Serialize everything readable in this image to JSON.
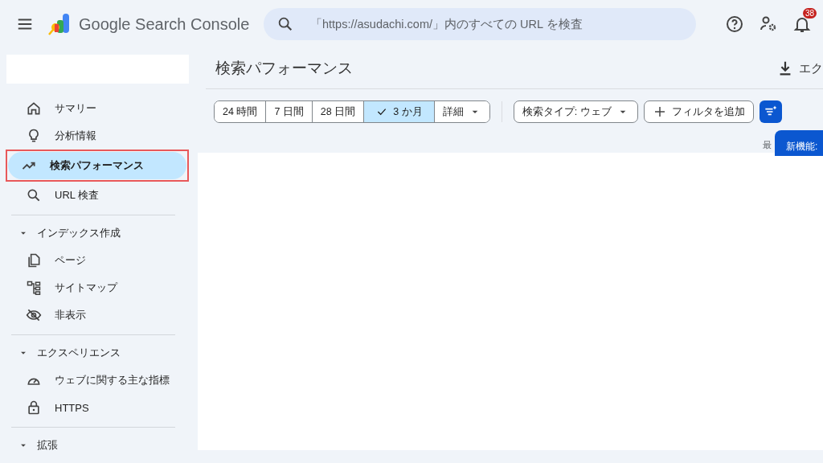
{
  "header": {
    "product_name": "Google Search Console",
    "search": {
      "placeholder": "「https://asudachi.com/」内のすべての URL を検査"
    },
    "notification_count": "38"
  },
  "sidebar": {
    "sections": [
      {
        "items": [
          {
            "kind": "home",
            "label": "サマリー",
            "selected": false,
            "highlighted": false
          },
          {
            "kind": "bulb",
            "label": "分析情報",
            "selected": false,
            "highlighted": false
          },
          {
            "kind": "trend",
            "label": "検索パフォーマンス",
            "selected": true,
            "highlighted": true
          },
          {
            "kind": "search",
            "label": "URL 検査",
            "selected": false,
            "highlighted": false
          }
        ]
      },
      {
        "label": "インデックス作成",
        "expanded": true,
        "items": [
          {
            "kind": "page",
            "label": "ページ",
            "selected": false,
            "highlighted": false
          },
          {
            "kind": "sitemap",
            "label": "サイトマップ",
            "selected": false,
            "highlighted": false
          },
          {
            "kind": "hidden",
            "label": "非表示",
            "selected": false,
            "highlighted": false
          }
        ]
      },
      {
        "label": "エクスペリエンス",
        "expanded": true,
        "items": [
          {
            "kind": "gauge",
            "label": "ウェブに関する主な指標",
            "selected": false,
            "highlighted": false
          },
          {
            "kind": "lock",
            "label": "HTTPS",
            "selected": false,
            "highlighted": false
          }
        ]
      },
      {
        "label": "拡張",
        "expanded": true
      }
    ]
  },
  "main": {
    "title": "検索パフォーマンス",
    "export_label": "エク",
    "date_ranges": [
      {
        "label": "24 時間",
        "selected": false
      },
      {
        "label": "7 日間",
        "selected": false
      },
      {
        "label": "28 日間",
        "selected": false
      },
      {
        "label": "3 か月",
        "selected": true
      },
      {
        "label": "詳細",
        "selected": false
      }
    ],
    "search_type": "検索タイプ: ウェブ",
    "add_filter": "フィルタを追加",
    "updated_label": "最",
    "tooltip": "新機能:"
  }
}
